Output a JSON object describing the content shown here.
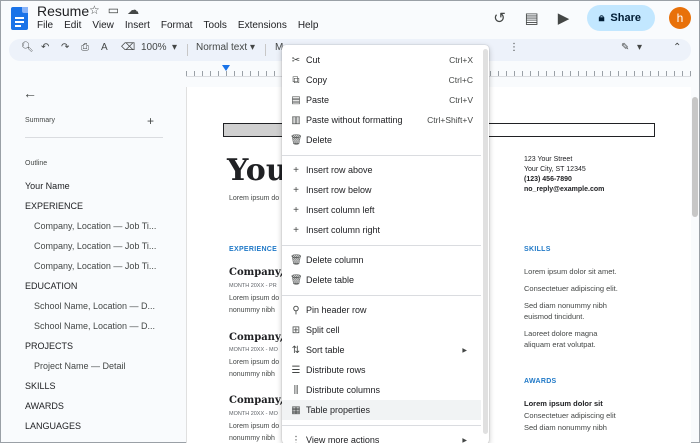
{
  "app": {
    "title": "Resume",
    "menus": [
      "File",
      "Edit",
      "View",
      "Insert",
      "Format",
      "Tools",
      "Extensions",
      "Help"
    ],
    "share_label": "Share",
    "avatar_initial": "h",
    "colors": {
      "accent": "#1a73e8",
      "share_bg": "#c2e7ff",
      "avatar": "#e8710a",
      "section_blue": "#2079c7"
    }
  },
  "toolbar": {
    "zoom": "100%",
    "style": "Normal text",
    "style_trunc": "M"
  },
  "sidebar": {
    "summary_label": "Summary",
    "outline_label": "Outline",
    "items": [
      {
        "label": "Your Name",
        "level": 1
      },
      {
        "label": "EXPERIENCE",
        "level": 1
      },
      {
        "label": "Company, Location — Job Ti...",
        "level": 2
      },
      {
        "label": "Company, Location — Job Ti...",
        "level": 2
      },
      {
        "label": "Company, Location — Job Ti...",
        "level": 2
      },
      {
        "label": "EDUCATION",
        "level": 1
      },
      {
        "label": "School Name, Location — D...",
        "level": 2
      },
      {
        "label": "School Name, Location — D...",
        "level": 2
      },
      {
        "label": "PROJECTS",
        "level": 1
      },
      {
        "label": "Project Name — Detail",
        "level": 2
      },
      {
        "label": "SKILLS",
        "level": 1
      },
      {
        "label": "AWARDS",
        "level": 1
      },
      {
        "label": "LANGUAGES",
        "level": 1
      }
    ]
  },
  "document": {
    "name_partial": "Your",
    "intro": "Lorem ipsum do",
    "experience_head": "EXPERIENCE",
    "company1": "Company, L",
    "meta1": "MONTH 20XX - PR",
    "body1": [
      "Lorem ipsum do",
      "nonummy nibh"
    ],
    "company2": "Company, L",
    "meta2": "MONTH 20XX - MO",
    "body2": [
      "Lorem ipsum do",
      "nonummy nibh"
    ],
    "company3": "Company, L",
    "meta3": "MONTH 20XX - MO",
    "body3": [
      "Lorem ipsum do",
      "nonummy nibh"
    ],
    "address": [
      "123 Your Street",
      "Your City, ST 12345"
    ],
    "phone": "(123) 456-7890",
    "email": "no_reply@example.com",
    "skills_head": "SKILLS",
    "skills": [
      "Lorem ipsum dolor sit amet.",
      "Consectetuer adipiscing elit.",
      "Sed diam nonummy nibh",
      "euismod tincidunt.",
      "Laoreet dolore magna",
      "aliquam erat volutpat."
    ],
    "awards_head": "AWARDS",
    "awards": [
      "Lorem ipsum dolor sit",
      "Consectetuer adipiscing elit",
      "Sed diam nonummy nibh"
    ]
  },
  "context_menu": {
    "items": [
      {
        "label": "Cut",
        "shortcut": "Ctrl+X",
        "icon": "scissors-icon"
      },
      {
        "label": "Copy",
        "shortcut": "Ctrl+C",
        "icon": "copy-icon"
      },
      {
        "label": "Paste",
        "shortcut": "Ctrl+V",
        "icon": "paste-icon"
      },
      {
        "label": "Paste without formatting",
        "shortcut": "Ctrl+Shift+V",
        "icon": "paste-plain-icon"
      },
      {
        "label": "Delete",
        "shortcut": "",
        "icon": "trash-icon"
      },
      {
        "label": "Insert row above",
        "shortcut": "",
        "icon": "plus-icon"
      },
      {
        "label": "Insert row below",
        "shortcut": "",
        "icon": "plus-icon"
      },
      {
        "label": "Insert column left",
        "shortcut": "",
        "icon": "plus-icon"
      },
      {
        "label": "Insert column right",
        "shortcut": "",
        "icon": "plus-icon"
      },
      {
        "label": "Delete column",
        "shortcut": "",
        "icon": "trash-icon"
      },
      {
        "label": "Delete table",
        "shortcut": "",
        "icon": "trash-icon"
      },
      {
        "label": "Pin header row",
        "shortcut": "",
        "icon": "pin-icon"
      },
      {
        "label": "Split cell",
        "shortcut": "",
        "icon": "split-cell-icon"
      },
      {
        "label": "Sort table",
        "shortcut": "",
        "icon": "sort-icon"
      },
      {
        "label": "Distribute rows",
        "shortcut": "",
        "icon": "distribute-rows-icon"
      },
      {
        "label": "Distribute columns",
        "shortcut": "",
        "icon": "distribute-columns-icon"
      },
      {
        "label": "Table properties",
        "shortcut": "",
        "icon": "table-properties-icon"
      },
      {
        "label": "View more actions",
        "shortcut": "",
        "icon": "more-vertical-icon"
      }
    ]
  }
}
